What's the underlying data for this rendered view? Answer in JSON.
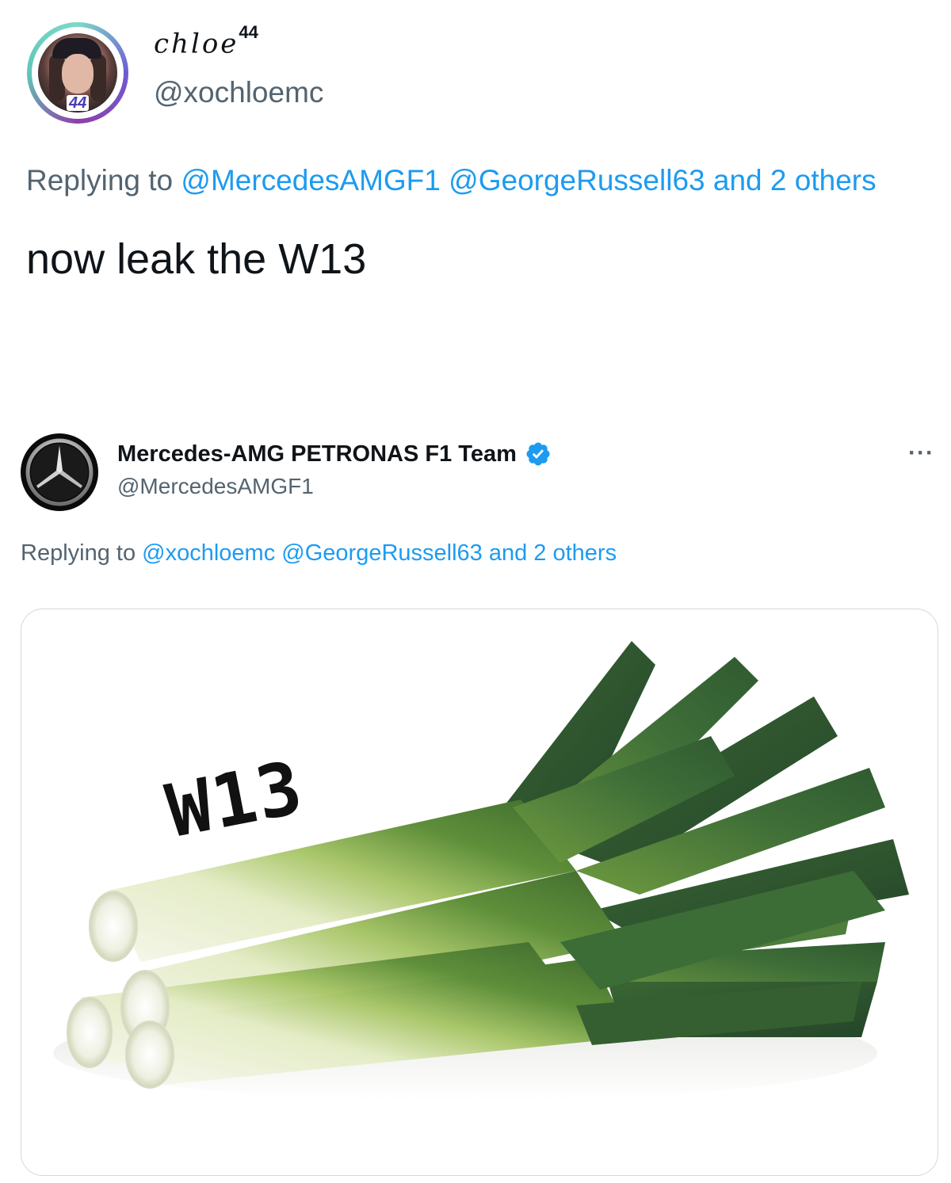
{
  "tweet1": {
    "display_name": "chloe",
    "display_name_sup": "44",
    "handle": "@xochloemc",
    "avatar_badge": "44",
    "replying_prefix": "Replying to",
    "reply_mentions": [
      "@MercedesAMGF1",
      "@GeorgeRussell63"
    ],
    "reply_others": "and 2 others",
    "text": "now leak the W13"
  },
  "tweet2": {
    "display_name": "Mercedes-AMG PETRONAS F1 Team",
    "handle": "@MercedesAMGF1",
    "more_label": "···",
    "replying_prefix": "Replying to",
    "reply_mentions": [
      "@xochloemc",
      "@GeorgeRussell63"
    ],
    "reply_others": "and 2 others",
    "media_caption": "W13"
  },
  "colors": {
    "link": "#1d9bf0",
    "secondary_text": "#536471",
    "primary_text": "#0f1419",
    "verified_badge": "#1d9bf0"
  },
  "icons": {
    "verified": "verified-badge-icon",
    "more": "more-options-icon"
  }
}
